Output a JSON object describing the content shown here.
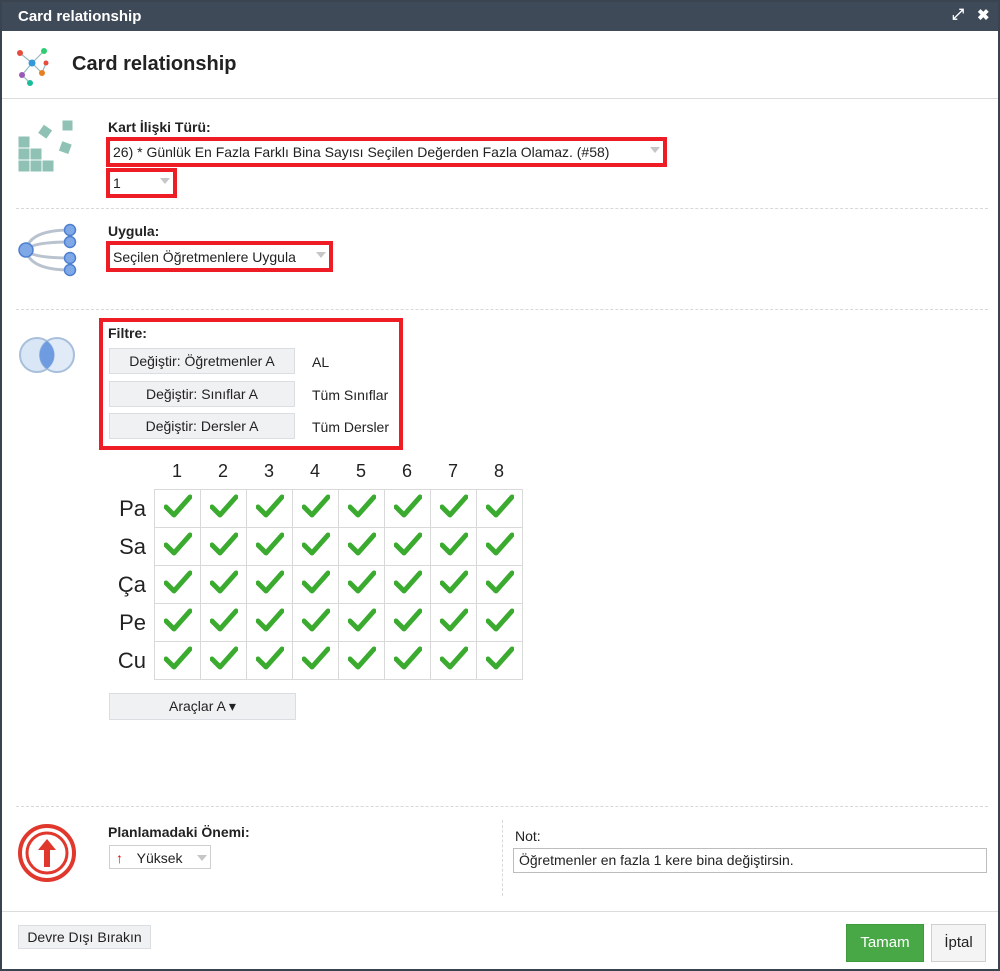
{
  "window": {
    "title": "Card relationship",
    "expand_icon": "expand-icon",
    "close_icon": "close-icon"
  },
  "header": {
    "title": "Card relationship"
  },
  "relation": {
    "label": "Kart İlişki Türü:",
    "type_value": "26) * Günlük En Fazla Farklı Bina Sayısı Seçilen Değerden Fazla Olamaz. (#58)",
    "count_value": "1"
  },
  "apply": {
    "label": "Uygula:",
    "value": "Seçilen Öğretmenlere Uygula"
  },
  "filter": {
    "label": "Filtre:",
    "rows": [
      {
        "button": "Değiştir: Öğretmenler A",
        "value": "AL"
      },
      {
        "button": "Değiştir: Sınıflar A",
        "value": "Tüm Sınıflar"
      },
      {
        "button": "Değiştir: Dersler A",
        "value": "Tüm Dersler"
      }
    ]
  },
  "grid": {
    "columns": [
      "1",
      "2",
      "3",
      "4",
      "5",
      "6",
      "7",
      "8"
    ],
    "rows": [
      "Pa",
      "Sa",
      "Ça",
      "Pe",
      "Cu"
    ],
    "cell_icon": "checkmark-icon"
  },
  "tools_button": "Araçlar A ▾",
  "importance": {
    "label": "Planlamadaki Önemi:",
    "value": "Yüksek"
  },
  "note": {
    "label": "Not:",
    "value": "Öğretmenler en fazla 1 kere bina değiştirsin."
  },
  "footer": {
    "disable_label": "Devre Dışı Bırakın",
    "ok_label": "Tamam",
    "cancel_label": "İptal"
  },
  "colors": {
    "titlebar": "#3f4a58",
    "highlight": "#ee1c25",
    "ok": "#48a846",
    "check": "#3aab2f"
  }
}
